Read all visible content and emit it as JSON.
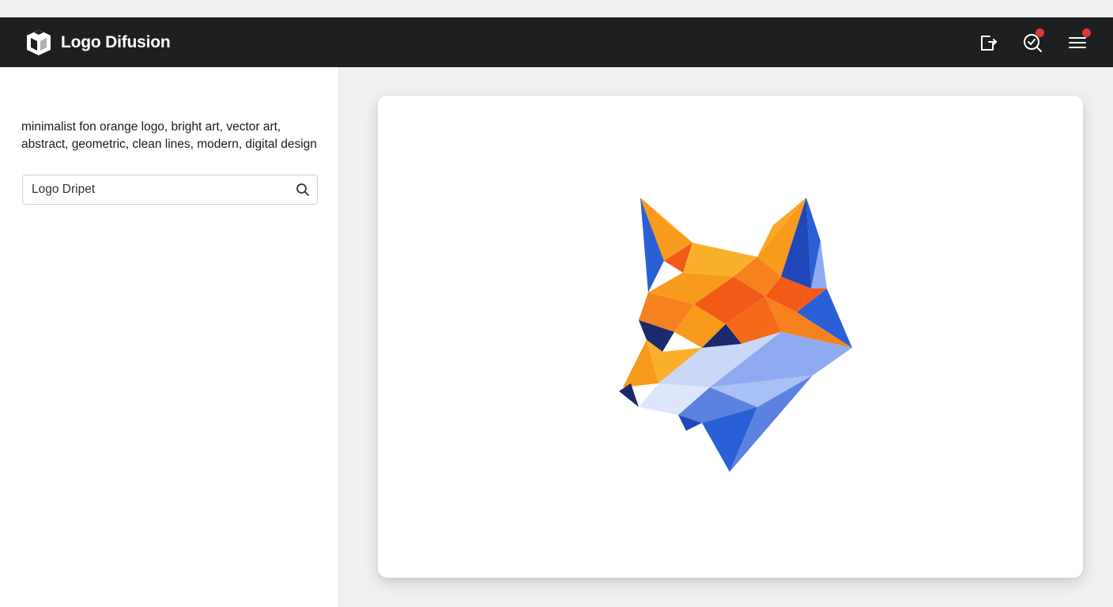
{
  "app": {
    "title": "Logo Difusion"
  },
  "header": {
    "icons": {
      "logo": "logo-cube-icon",
      "share": "share-export-icon",
      "notifications": "search-check-icon",
      "menu": "hamburger-menu-icon"
    },
    "badge_color": "#e0363a"
  },
  "sidebar": {
    "prompt": "minimalist fon orange logo, bright art, vector art, abstract, geometric, clean lines, modern, digital design",
    "search": {
      "value": "Logo Dripet",
      "icon": "search-icon"
    }
  },
  "preview": {
    "image": "geometric-fox-logo",
    "colors": {
      "orange": "#f5821f",
      "orange_light": "#fba625",
      "red_orange": "#f25a18",
      "blue": "#2a5fd6",
      "blue_light": "#8eaaf0",
      "navy": "#1a2a6c"
    }
  }
}
